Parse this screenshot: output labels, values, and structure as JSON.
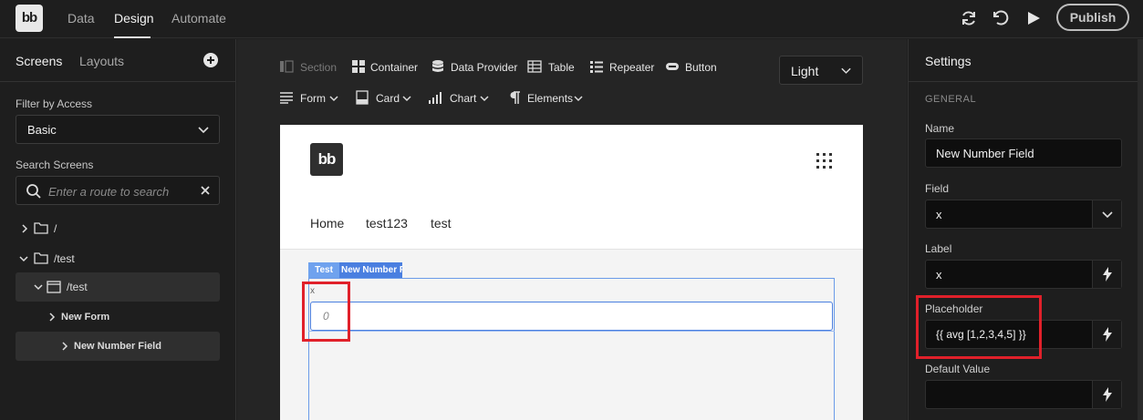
{
  "topbar": {
    "logo_text": "bb",
    "tabs": [
      "Data",
      "Design",
      "Automate"
    ],
    "active_tab": "Design",
    "publish_label": "Publish",
    "icons": [
      "refresh-icon",
      "undo-icon",
      "play-icon"
    ]
  },
  "left_panel": {
    "tabs": [
      "Screens",
      "Layouts"
    ],
    "active_tab": "Screens",
    "filter_label": "Filter by Access",
    "filter_value": "Basic",
    "search_label": "Search Screens",
    "search_placeholder": "Enter a route to search",
    "tree": [
      {
        "label": "/",
        "kind": "folder",
        "expanded": false
      },
      {
        "label": "/test",
        "kind": "folder",
        "expanded": true
      },
      {
        "label": "/test",
        "kind": "screen",
        "expanded": true,
        "selected": true
      },
      {
        "label": "New Form",
        "kind": "component",
        "expanded": false
      },
      {
        "label": "New Number Field",
        "kind": "component",
        "expanded": false,
        "selected": true
      }
    ]
  },
  "toolbar": {
    "row1": [
      {
        "label": "Section",
        "icon": "section-icon",
        "disabled": true
      },
      {
        "label": "Container",
        "icon": "container-icon",
        "disabled": false
      },
      {
        "label": "Data Provider",
        "icon": "database-icon",
        "disabled": false
      },
      {
        "label": "Table",
        "icon": "table-icon",
        "disabled": false
      },
      {
        "label": "Repeater",
        "icon": "list-icon",
        "disabled": false
      },
      {
        "label": "Button",
        "icon": "button-icon",
        "disabled": false
      }
    ],
    "row2": [
      {
        "label": "Form",
        "icon": "form-icon"
      },
      {
        "label": "Card",
        "icon": "card-icon"
      },
      {
        "label": "Chart",
        "icon": "chart-icon"
      },
      {
        "label": "Elements",
        "icon": "paragraph-icon"
      }
    ],
    "theme_value": "Light"
  },
  "preview": {
    "logo_text": "bb",
    "nav_links": [
      "Home",
      "test123",
      "test"
    ],
    "component_tag_prefix": "Test",
    "component_tag_name": "New Number Field",
    "field_label": "x",
    "field_placeholder": "0"
  },
  "settings": {
    "title": "Settings",
    "section": "GENERAL",
    "name_label": "Name",
    "name_value": "New Number Field",
    "field_label": "Field",
    "field_value": "x",
    "label_label": "Label",
    "label_value": "x",
    "placeholder_label": "Placeholder",
    "placeholder_value": "{{ avg [1,2,3,4,5] }}",
    "default_label": "Default Value",
    "default_value": ""
  },
  "colors": {
    "highlight": "#e0202a",
    "selection_blue": "#4a7fe0"
  }
}
